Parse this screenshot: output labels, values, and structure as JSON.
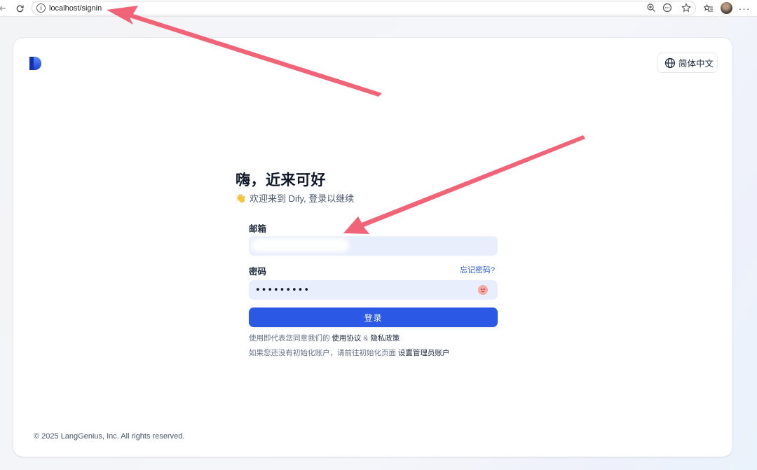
{
  "browser": {
    "url": "localhost/signin"
  },
  "header": {
    "language_label": "简体中文"
  },
  "signin": {
    "title": "嗨，近来可好",
    "wave_emoji": "👋",
    "subtitle": "欢迎来到 Dify, 登录以继续",
    "email_label": "邮箱",
    "email_value": "",
    "password_label": "密码",
    "password_value": "•••••••••",
    "forgot_link": "忘记密码?",
    "submit_label": "登录",
    "terms_prefix": "使用即代表您同意我们的",
    "terms_link": "使用协议",
    "terms_and": "&",
    "privacy_link": "隐私政策",
    "init_prefix": "如果您还没有初始化账户，请前往初始化页面",
    "init_link": "设置管理员账户"
  },
  "footer": {
    "copyright": "© 2025 LangGenius, Inc. All rights reserved."
  },
  "colors": {
    "primary": "#2b59e6",
    "input_bg": "#e8eefc",
    "annotation_arrow": "#f0566a"
  },
  "icons": {
    "reload": "reload-icon",
    "info": "info-icon",
    "zoom": "zoom-icon",
    "reader": "reader-icon",
    "star": "star-icon",
    "favorites": "favorites-icon",
    "more": "more-icon",
    "globe": "globe-icon",
    "eye": "eye-icon"
  }
}
